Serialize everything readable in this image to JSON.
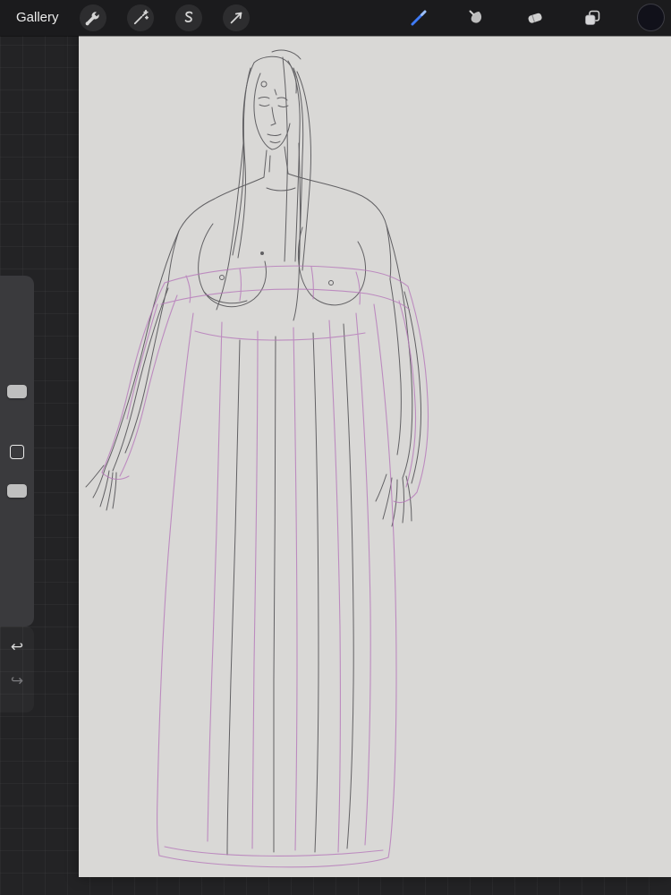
{
  "toolbar": {
    "gallery_label": "Gallery",
    "left_tools": [
      {
        "label": "Actions",
        "icon": "wrench-icon"
      },
      {
        "label": "Adjustments",
        "icon": "magic-wand-icon"
      },
      {
        "label": "Selection",
        "icon": "selection-icon"
      },
      {
        "label": "Transform",
        "icon": "transform-arrow-icon"
      }
    ],
    "right_tools": [
      {
        "label": "Paint",
        "icon": "brush-icon",
        "active": true
      },
      {
        "label": "Smudge",
        "icon": "smudge-icon"
      },
      {
        "label": "Erase",
        "icon": "eraser-icon"
      },
      {
        "label": "Layers",
        "icon": "layers-icon"
      },
      {
        "label": "Color",
        "icon": "color-swatch"
      }
    ]
  },
  "sidebar": {
    "sliders": [
      {
        "name": "brush-size"
      },
      {
        "name": "brush-opacity"
      }
    ],
    "modify_button": "modify",
    "undo_glyph": "↩",
    "redo_glyph": "↪"
  },
  "canvas": {
    "description": "Pencil line sketch of a long-haired woman wearing an off-shoulder flowing gown; dark graphite lines for figure, purple lines for the dress and sleeves"
  },
  "colors": {
    "accent_blue": "#3f7bf6",
    "accent_blue_light": "#9cc0ff",
    "topbar_bg": "#1b1b1d",
    "workspace_bg": "#232325",
    "canvas_bg": "#d9d8d6",
    "sketch_line": "#4d4c50",
    "dress_line": "#b678ba",
    "current_color": "#11111a",
    "icon_gray": "#d5d5d5"
  }
}
